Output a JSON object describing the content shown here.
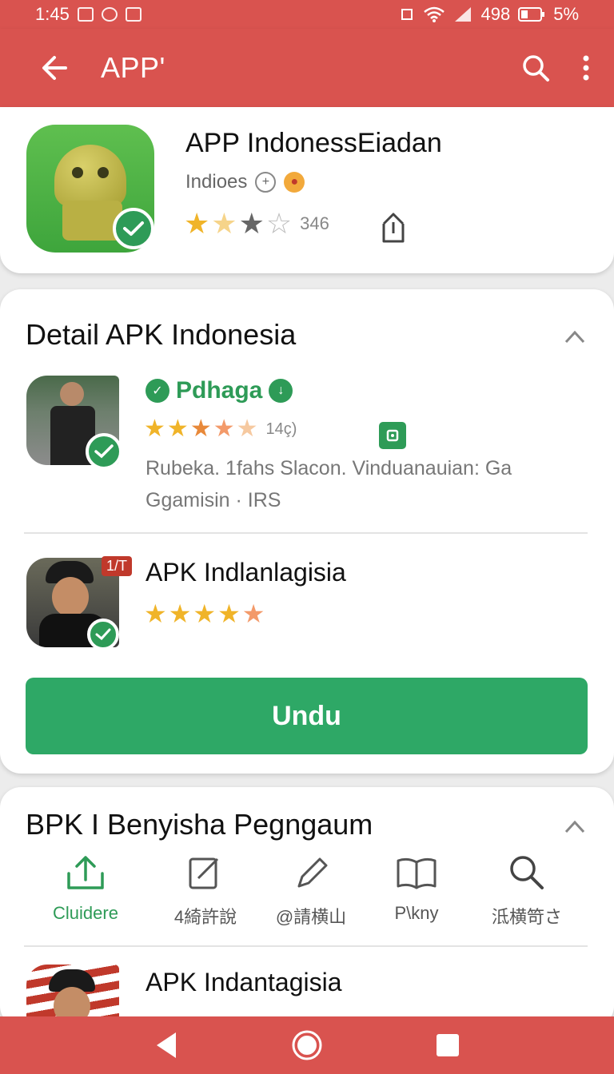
{
  "status_bar": {
    "time": "1:45",
    "battery_text": "498",
    "battery_percent": "5%"
  },
  "app_bar": {
    "title": "APP'",
    "back_icon": "arrow-left-icon",
    "search_icon": "search-icon",
    "menu_icon": "more-vert-icon",
    "color": "#d9534f"
  },
  "app_header": {
    "name": "APP IndonessEiadan",
    "developer": "Indioes",
    "rating_count": "346",
    "rating": 2.5
  },
  "detail_section": {
    "title": "Detail APK Indonesia",
    "items": [
      {
        "title": "Pdhaga",
        "rating_count": "14ç)",
        "rating": 3.5,
        "desc_line1": "Rubeka. 1fahs Slacon.  Vinduanauian: Ga",
        "desc_line2": "Ggamisin · IRS"
      },
      {
        "title": "APK Indlanlagisia",
        "badge": "1/T",
        "rating": 5
      }
    ],
    "download_label": "Undu"
  },
  "bpk_section": {
    "title": "BPK I Benyisha Pegngaum",
    "actions": [
      {
        "label": "Cluidere",
        "icon": "share-upload-icon"
      },
      {
        "label": "4綺許說",
        "icon": "edit-note-icon"
      },
      {
        "label": "@請横山",
        "icon": "pen-icon"
      },
      {
        "label": "P\\kny",
        "icon": "book-icon"
      },
      {
        "label": "泜横笴さ",
        "icon": "search-icon"
      }
    ],
    "item_title": "APK Indantagisia"
  },
  "colors": {
    "accent_red": "#d9534f",
    "brand_green": "#2ea866",
    "star_gold": "#f0b429"
  }
}
